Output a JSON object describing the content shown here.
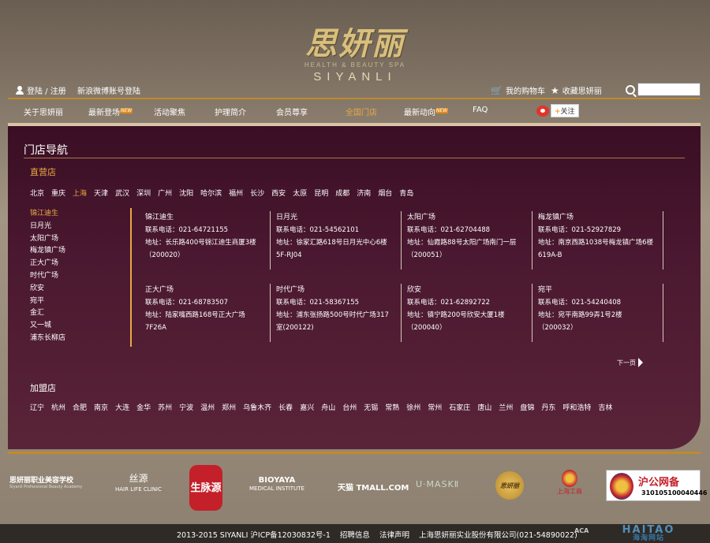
{
  "brand": {
    "logo_cn": "思妍丽",
    "logo_sub": "HEALTH & BEAUTY SPA",
    "logo_en": "SIYANLI"
  },
  "topbar": {
    "login": "登陆 / 注册",
    "weibo_login": "新浪微博账号登陆",
    "cart": "我的购物车",
    "favorite": "收藏思妍丽",
    "search_placeholder": ""
  },
  "nav": {
    "items": [
      {
        "label": "关于思妍丽",
        "badge": ""
      },
      {
        "label": "最新登场",
        "badge": "NEW"
      },
      {
        "label": "活动聚焦",
        "badge": ""
      },
      {
        "label": "护理简介",
        "badge": ""
      },
      {
        "label": "会员尊享",
        "badge": ""
      },
      {
        "label": "全国门店",
        "badge": ""
      },
      {
        "label": "最新动向",
        "badge": "NEW"
      },
      {
        "label": "FAQ",
        "badge": ""
      }
    ],
    "follow": "关注"
  },
  "panel": {
    "title": "门店导航",
    "direct_label": "直营店",
    "direct_cities": [
      "北京",
      "重庆",
      "上海",
      "天津",
      "武汉",
      "深圳",
      "广州",
      "沈阳",
      "哈尔滨",
      "福州",
      "长沙",
      "西安",
      "太原",
      "昆明",
      "成都",
      "济南",
      "烟台",
      "青岛"
    ],
    "active_city": "上海",
    "stores": [
      "锦江迪生",
      "日月光",
      "太阳广场",
      "梅龙镇广场",
      "正大广场",
      "时代广场",
      "欣安",
      "宛平",
      "金汇",
      "又一城",
      "浦东长柳店"
    ],
    "active_store": "锦江迪生",
    "cards": [
      {
        "name": "锦江迪生",
        "phone": "联系电话：021-64721155",
        "addr1": "地址：长乐路400号锦江迪生商厦3楼",
        "addr2": "（200020）"
      },
      {
        "name": "日月光",
        "phone": "联系电话：021-54562101",
        "addr1": "地址：徐家汇路618号日月光中心6楼",
        "addr2": "5F-RJ04"
      },
      {
        "name": "太阳广场",
        "phone": "联系电话：021-62704488",
        "addr1": "地址：仙霞路88号太阳广场南门一层",
        "addr2": "（200051）"
      },
      {
        "name": "梅龙镇广场",
        "phone": "联系电话：021-52927829",
        "addr1": "地址：南京西路1038号梅龙镇广场6楼",
        "addr2": "619A-B"
      },
      {
        "name": "正大广场",
        "phone": "联系电话：021-68783507",
        "addr1": "地址：陆家嘴西路168号正大广场",
        "addr2": "7F26A"
      },
      {
        "name": "时代广场",
        "phone": "联系电话：021-58367155",
        "addr1": "地址：浦东张扬路500号时代广场317",
        "addr2": "室(200122)"
      },
      {
        "name": "欣安",
        "phone": "联系电话：021-62892722",
        "addr1": "地址：镇宁路200号欣安大厦1楼",
        "addr2": "（200040）"
      },
      {
        "name": "宛平",
        "phone": "联系电话：021-54240408",
        "addr1": "地址：宛平南路99弄1号2楼",
        "addr2": "（200032）"
      }
    ],
    "next_page": "下一页",
    "franchise_label": "加盟店",
    "franchise_cities": [
      "辽宁",
      "杭州",
      "合肥",
      "南京",
      "大连",
      "金华",
      "苏州",
      "宁波",
      "温州",
      "郑州",
      "乌鲁木齐",
      "长春",
      "嘉兴",
      "舟山",
      "台州",
      "无锡",
      "常熟",
      "徐州",
      "常州",
      "石家庄",
      "唐山",
      "兰州",
      "盘锦",
      "丹东",
      "呼和浩特",
      "吉林"
    ]
  },
  "partners": {
    "p1_big": "思妍丽职业美容学校",
    "p1_small": "Siyanli Professional Beauty Academy",
    "p2_big": "丝源",
    "p2_small": "HAIR LIFE CLINIC",
    "p3": "生脉源",
    "p4_big": "BIOYAYA",
    "p4_small": "MEDICAL INSTITUTE",
    "p5": "天猫 TMALL.COM",
    "p6": "U·MASKⅡ",
    "p7": "思妍丽",
    "p8": "上海工商",
    "p9_title": "沪公网备",
    "p9_num": "310105100040446"
  },
  "footer": {
    "copyright": "2013-2015 SIYANLI 沪ICP备12030832号-1",
    "jobs": "招聘信息",
    "legal": "法律声明",
    "company": "上海思妍丽实业股份有限公司(021-54890022)",
    "aca": "ACA",
    "watermark_big": "HAITAO",
    "watermark_small": "海淘网站"
  }
}
